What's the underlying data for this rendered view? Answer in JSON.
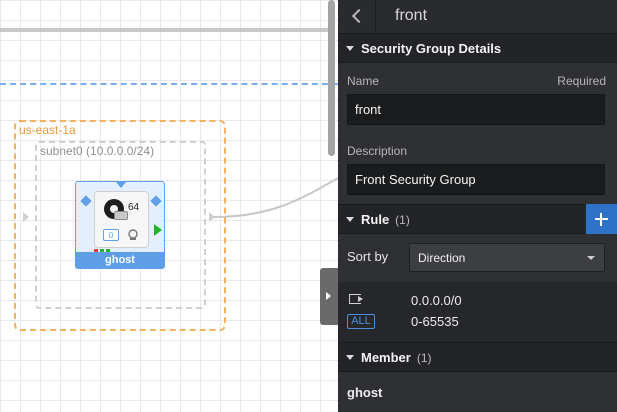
{
  "canvas": {
    "availability_zone": "us-east-1a",
    "subnet": "subnet0 (10.0.0.0/24)",
    "instance": {
      "name": "ghost",
      "arch": "64",
      "volume_count": "0",
      "state_colors": [
        "#e03c3c",
        "#27b327",
        "#27b327"
      ]
    }
  },
  "panel": {
    "title": "front",
    "details": {
      "heading": "Security Group Details",
      "name_label": "Name",
      "required_label": "Required",
      "name_value": "front",
      "description_label": "Description",
      "description_value": "Front Security Group"
    },
    "rule": {
      "heading": "Rule",
      "count": "(1)",
      "sort_label": "Sort by",
      "sort_value": "Direction",
      "items": [
        {
          "target": "0.0.0.0/0",
          "protocol": "ALL",
          "ports": "0-65535"
        }
      ]
    },
    "member": {
      "heading": "Member",
      "count": "(1)",
      "items": [
        "ghost"
      ]
    }
  }
}
